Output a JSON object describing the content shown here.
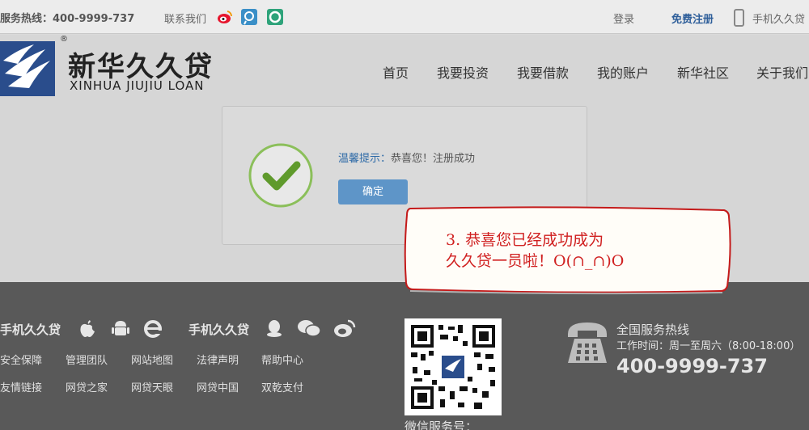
{
  "topbar": {
    "hotline": "服务热线：400-9999-737",
    "contact": "联系我们",
    "login": "登录",
    "register": "免费注册",
    "mobile": "手机久久贷"
  },
  "logo": {
    "cn": "新华久久贷",
    "en": "XINHUA JIUJIU LOAN",
    "reg": "®"
  },
  "nav": [
    "首页",
    "我要投资",
    "我要借款",
    "我的账户",
    "新华社区",
    "关于我们"
  ],
  "dialog": {
    "tip_label": "温馨提示：",
    "tip_msg": "恭喜您！注册成功",
    "ok": "确定"
  },
  "note": {
    "line1": "3. 恭喜您已经成功成为",
    "line2": "久久贷一员啦！O(∩_∩)O"
  },
  "footer": {
    "mobile_title_1": "手机久久贷",
    "mobile_title_2": "手机久久贷",
    "links_row1": [
      "安全保障",
      "管理团队",
      "网站地图",
      "法律声明",
      "帮助中心"
    ],
    "links_row2": [
      "友情链接",
      "网贷之家",
      "网贷天眼",
      "网贷中国",
      "双乾支付"
    ],
    "wechat": "微信服务号：",
    "service_title": "全国服务热线",
    "service_hours": "工作时间：周一至周六（8:00-18:00）",
    "service_number": "400-9999-737"
  },
  "colors": {
    "accent": "#2e6aa7",
    "button": "#5e95c8",
    "footer": "#595959",
    "note_text": "#d02020"
  }
}
